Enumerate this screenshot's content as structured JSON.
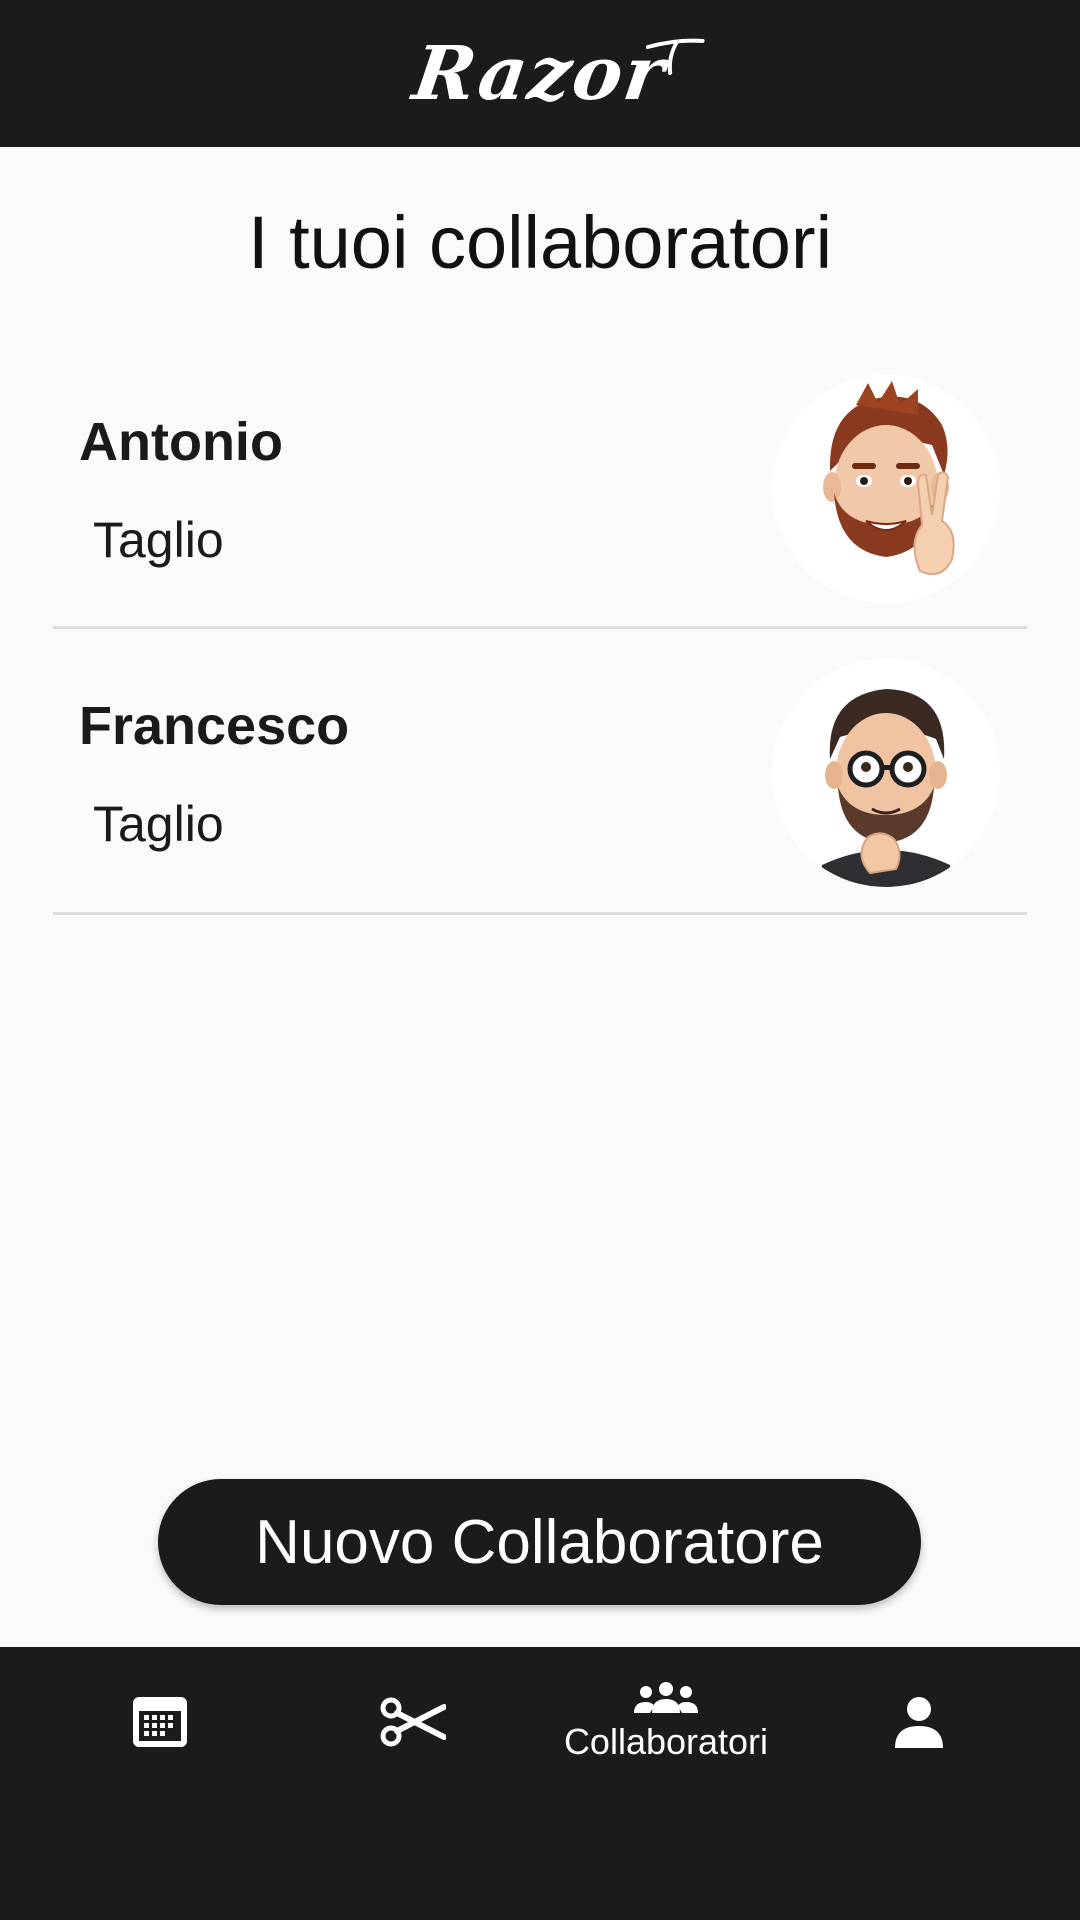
{
  "header": {
    "logo_text": "Razor"
  },
  "page": {
    "title": "I tuoi collaboratori"
  },
  "collaborators": [
    {
      "name": "Antonio",
      "service": "Taglio",
      "avatar_icon": "memoji-beard-peace-avatar"
    },
    {
      "name": "Francesco",
      "service": "Taglio",
      "avatar_icon": "memoji-glasses-thinking-avatar"
    }
  ],
  "actions": {
    "new_collaborator_label": "Nuovo Collaboratore"
  },
  "bottom_nav": {
    "items": [
      {
        "icon": "calendar-icon",
        "label": ""
      },
      {
        "icon": "scissors-icon",
        "label": ""
      },
      {
        "icon": "people-icon",
        "label": "Collaboratori",
        "active": true
      },
      {
        "icon": "person-icon",
        "label": ""
      }
    ]
  },
  "colors": {
    "bar_background": "#1b1b1b",
    "page_background": "#fafafa",
    "divider": "#dddddd",
    "text": "#1a1a1a"
  }
}
